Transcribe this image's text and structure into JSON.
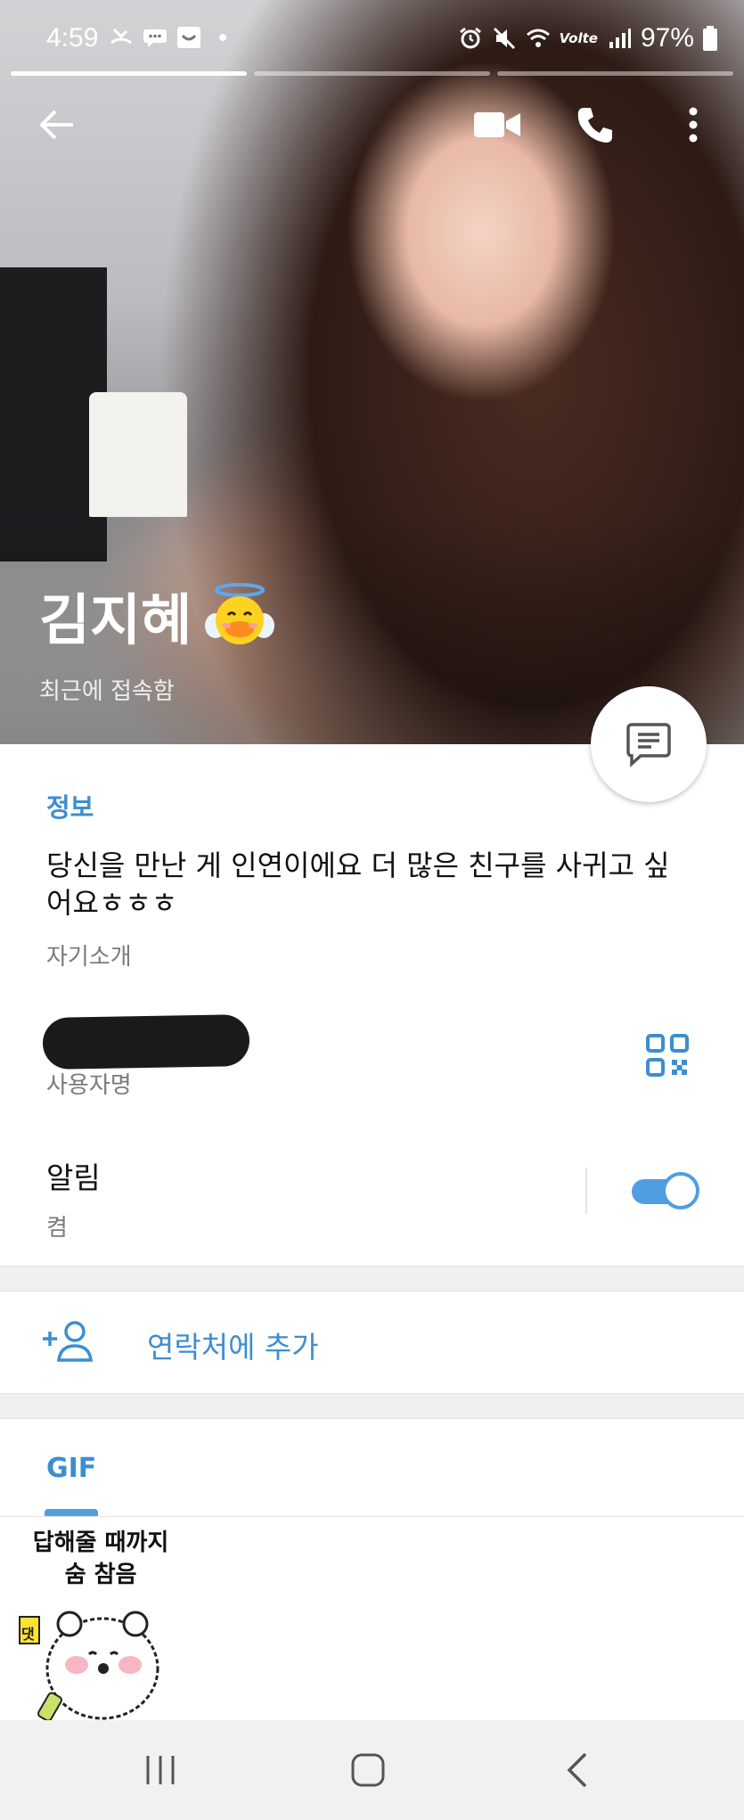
{
  "status_bar": {
    "time": "4:59",
    "battery": "97%",
    "network": "Volte"
  },
  "header": {
    "back_icon": "arrow-left-icon",
    "video_icon": "video-camera-icon",
    "call_icon": "phone-icon",
    "more_icon": "more-vertical-icon"
  },
  "profile": {
    "name": "김지혜",
    "emoji": "🐥",
    "last_seen": "최근에 접속함"
  },
  "info": {
    "section_title": "정보",
    "bio": "당신을 만난 게 인연이에요 더 많은 친구를 사귀고 싶어요ㅎㅎㅎ",
    "bio_caption": "자기소개",
    "username_caption": "사용자명",
    "notifications_label": "알림",
    "notifications_value": "켬",
    "notifications_on": true
  },
  "add_contact": {
    "label": "연락처에 추가"
  },
  "media": {
    "tab_label": "GIF",
    "gif_caption_line1": "답해줄 때까지",
    "gif_caption_line2": "숨 참음",
    "gif_badge": "댓"
  },
  "colors": {
    "accent": "#3d8ed0",
    "toggle": "#4f9ee0"
  }
}
